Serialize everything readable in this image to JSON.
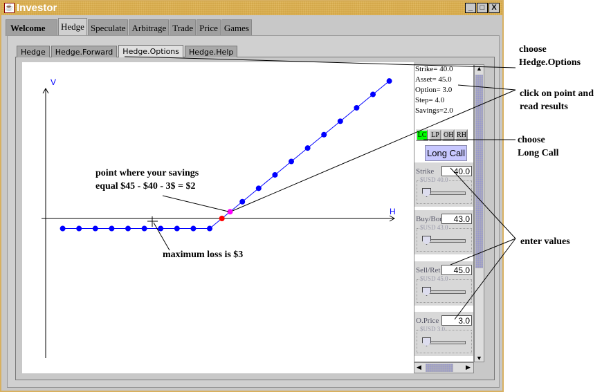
{
  "window": {
    "title": "Investor",
    "controls": [
      "_",
      "□",
      "X"
    ]
  },
  "tabs": [
    {
      "label": "Welcome"
    },
    {
      "label": "Hedge",
      "active": true
    },
    {
      "label": "Speculate"
    },
    {
      "label": "Arbitrage"
    },
    {
      "label": "Trade"
    },
    {
      "label": "Price"
    },
    {
      "label": "Games"
    }
  ],
  "subtabs": [
    {
      "label": "Hedge"
    },
    {
      "label": "Hedge.Forward"
    },
    {
      "label": "Hedge.Options",
      "active": true
    },
    {
      "label": "Hedge.Help"
    }
  ],
  "results": [
    "Strike= 40.0",
    "Asset= 45.0",
    "Option= 3.0",
    "Step= 4.0",
    "Savings=2.0"
  ],
  "strategy_buttons": [
    {
      "label": "LC",
      "active": true,
      "color": "#00ff00"
    },
    {
      "label": "LP"
    },
    {
      "label": "OH"
    },
    {
      "label": "RH"
    }
  ],
  "strategy_label": "Long Call",
  "inputs": [
    {
      "label": "Strike",
      "value": "40.0",
      "slider_caption": "$USD 40.0"
    },
    {
      "label": "Buy/Bor",
      "value": "43.0",
      "slider_caption": "$USD 43.0"
    },
    {
      "label": "Sell/Ret",
      "value": "45.0",
      "slider_caption": "$USD 45.0"
    },
    {
      "label": "O.Price",
      "value": "3.0",
      "slider_caption": "$USD 3.0"
    }
  ],
  "chart_data": {
    "type": "line",
    "xlabel": "H",
    "ylabel": "V",
    "series_color": "#0000ff",
    "points": [
      {
        "x": 4,
        "y": -3
      },
      {
        "x": 8,
        "y": -3
      },
      {
        "x": 12,
        "y": -3
      },
      {
        "x": 16,
        "y": -3
      },
      {
        "x": 20,
        "y": -3
      },
      {
        "x": 24,
        "y": -3
      },
      {
        "x": 28,
        "y": -3
      },
      {
        "x": 32,
        "y": -3
      },
      {
        "x": 36,
        "y": -3
      },
      {
        "x": 40,
        "y": -3
      },
      {
        "x": 43,
        "y": 0,
        "color": "#ff0000"
      },
      {
        "x": 45,
        "y": 2,
        "color": "#ff00ff"
      },
      {
        "x": 48,
        "y": 5
      },
      {
        "x": 52,
        "y": 9
      },
      {
        "x": 56,
        "y": 13
      },
      {
        "x": 60,
        "y": 17
      },
      {
        "x": 64,
        "y": 21
      },
      {
        "x": 68,
        "y": 25
      },
      {
        "x": 72,
        "y": 29
      },
      {
        "x": 76,
        "y": 33
      },
      {
        "x": 80,
        "y": 37
      },
      {
        "x": 84,
        "y": 41
      }
    ]
  },
  "annotations": {
    "savings": [
      "point where your savings",
      "equal $45 - $40 - 3$ = $2"
    ],
    "max_loss": "maximum loss is $3",
    "choose_tab": [
      "choose",
      "Hedge.Options"
    ],
    "click_point": [
      "click on point and",
      "read results"
    ],
    "choose_lc": [
      "choose",
      "Long Call"
    ],
    "enter_values": "enter values"
  }
}
